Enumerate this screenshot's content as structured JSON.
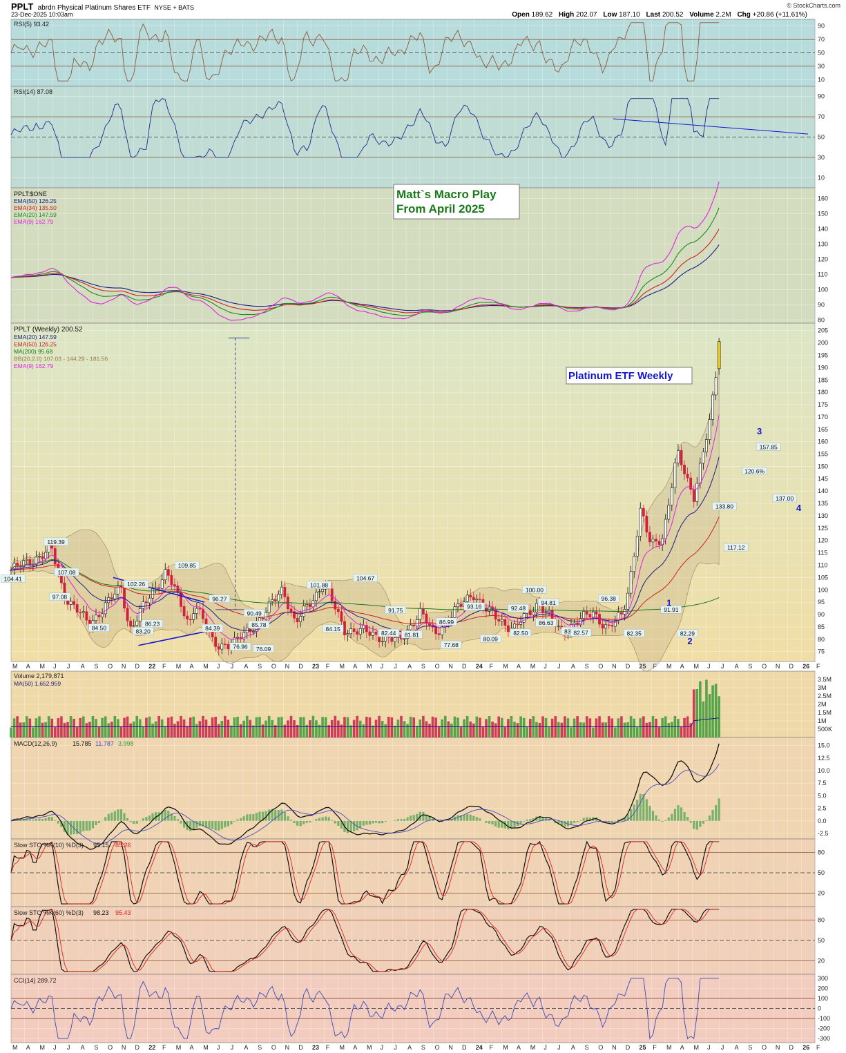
{
  "header": {
    "symbol": "PPLT",
    "name": "abrdn Physical Platinum Shares ETF",
    "exchange": "NYSE + BATS",
    "date": "23-Dec-2025 10:03am",
    "brand": "© StockCharts.com",
    "quote": {
      "open_label": "Open",
      "open": "189.62",
      "high_label": "High",
      "high": "202.07",
      "low_label": "Low",
      "low": "187.10",
      "last_label": "Last",
      "last": "200.52",
      "volume_label": "Volume",
      "volume": "2.2M",
      "chg_label": "Chg",
      "chg": "+20.86 (+11.61%)"
    }
  },
  "colors": {
    "up": "#2a9a2a",
    "down": "#d0213c",
    "ema50": "#1a1a8c",
    "ema34": "#cc2020",
    "ema20": "#1a8c1a",
    "ema9": "#e020e0",
    "blue_line": "#1515d0",
    "rsi5": "#8b5a3c",
    "rsi14": "#1a2a90"
  },
  "chart_data": [
    {
      "panel": "rsi5",
      "type": "line",
      "legend": "RSI(5) 93.42",
      "ylim": [
        0,
        100
      ],
      "yticks": [
        10,
        30,
        50,
        70,
        90
      ],
      "reference_lines": [
        30,
        50,
        70
      ],
      "last_value": 93.42
    },
    {
      "panel": "rsi14",
      "type": "line",
      "legend": "RSI(14) 87.08",
      "ylim": [
        0,
        100
      ],
      "yticks": [
        10,
        30,
        50,
        70,
        90
      ],
      "reference_lines": [
        30,
        50,
        70
      ],
      "last_value": 87.08
    },
    {
      "panel": "ratio",
      "type": "line",
      "title_label": "PPLT:$ONE",
      "annotation": [
        "Matt`s Macro Play",
        "From April 2025"
      ],
      "ylim": [
        78,
        167
      ],
      "yticks": [
        80,
        90,
        100,
        110,
        120,
        130,
        140,
        150,
        160
      ],
      "legend": [
        "EMA(50) 126.25",
        "EMA(34) 135.50",
        "EMA(20) 147.59",
        "EMA(9) 162.79"
      ]
    },
    {
      "panel": "price",
      "type": "candlestick",
      "title_label": "PPLT (Weekly) 200.52",
      "annotation": "Platinum ETF Weekly",
      "ylim": [
        71,
        208
      ],
      "yticks": [
        75,
        80,
        85,
        90,
        95,
        100,
        105,
        110,
        115,
        120,
        125,
        130,
        135,
        140,
        145,
        150,
        155,
        160,
        165,
        170,
        175,
        180,
        185,
        190,
        195,
        200,
        205
      ],
      "legend": [
        "EMA(20) 147.59",
        "EMA(50) 126.25",
        "MA(200) 95.68",
        "BB(20,2.0) 107.03 - 144.29 - 181.56",
        "EMA(9) 162.79"
      ],
      "last_value": 200.52,
      "price_labels": [
        {
          "t": 0.04,
          "v": 104.41,
          "text": "104.41"
        },
        {
          "t": 0.97,
          "v": 119.39,
          "text": "119.39"
        },
        {
          "t": 1.2,
          "v": 107.08,
          "text": "107.08"
        },
        {
          "t": 1.05,
          "v": 97.08,
          "text": "97.08"
        },
        {
          "t": 1.9,
          "v": 84.5,
          "text": "84.50"
        },
        {
          "t": 2.7,
          "v": 102.26,
          "text": "102.26"
        },
        {
          "t": 2.85,
          "v": 83.2,
          "text": "83.20"
        },
        {
          "t": 3.05,
          "v": 86.23,
          "text": "86.23"
        },
        {
          "t": 3.8,
          "v": 109.85,
          "text": "109.85"
        },
        {
          "t": 4.35,
          "v": 84.39,
          "text": "84.39"
        },
        {
          "t": 4.5,
          "v": 96.27,
          "text": "96.27"
        },
        {
          "t": 5.25,
          "v": 90.49,
          "text": "90.49"
        },
        {
          "t": 5.35,
          "v": 85.78,
          "text": "85.78"
        },
        {
          "t": 4.95,
          "v": 76.96,
          "text": "76.96"
        },
        {
          "t": 5.45,
          "v": 76.09,
          "text": "76.09"
        },
        {
          "t": 6.65,
          "v": 101.88,
          "text": "101.88"
        },
        {
          "t": 6.95,
          "v": 84.15,
          "text": "84.15"
        },
        {
          "t": 7.65,
          "v": 104.67,
          "text": "104.67"
        },
        {
          "t": 8.3,
          "v": 91.75,
          "text": "91.75"
        },
        {
          "t": 8.15,
          "v": 82.44,
          "text": "82.44"
        },
        {
          "t": 8.65,
          "v": 81.81,
          "text": "81.81"
        },
        {
          "t": 9.4,
          "v": 86.99,
          "text": "86.99"
        },
        {
          "t": 9.5,
          "v": 77.68,
          "text": "77.68"
        },
        {
          "t": 10.0,
          "v": 93.16,
          "text": "93.16"
        },
        {
          "t": 10.35,
          "v": 80.09,
          "text": "80.09"
        },
        {
          "t": 10.95,
          "v": 92.48,
          "text": "92.48"
        },
        {
          "t": 11.0,
          "v": 82.5,
          "text": "82.50"
        },
        {
          "t": 11.3,
          "v": 100.0,
          "text": "100.00"
        },
        {
          "t": 11.6,
          "v": 94.81,
          "text": "94.81"
        },
        {
          "t": 11.55,
          "v": 86.63,
          "text": "86.63"
        },
        {
          "t": 12.1,
          "v": 83.22,
          "text": "83.22"
        },
        {
          "t": 12.3,
          "v": 82.57,
          "text": "82.57"
        },
        {
          "t": 12.9,
          "v": 96.38,
          "text": "96.38"
        },
        {
          "t": 13.45,
          "v": 82.35,
          "text": "82.35"
        },
        {
          "t": 14.25,
          "v": 91.91,
          "text": "91.91"
        },
        {
          "t": 14.6,
          "v": 82.29,
          "text": "82.29"
        },
        {
          "t": 15.4,
          "v": 133.8,
          "text": "133.80"
        },
        {
          "t": 15.65,
          "v": 117.12,
          "text": "117.12"
        },
        {
          "t": 16.05,
          "v": 148.0,
          "text": "120.6%"
        },
        {
          "t": 16.35,
          "v": 157.85,
          "text": "157.85"
        },
        {
          "t": 16.7,
          "v": 137.0,
          "text": "137.00"
        }
      ],
      "wave_labels": [
        {
          "t": 14.15,
          "v": 93.5,
          "text": "1"
        },
        {
          "t": 14.6,
          "v": 78.0,
          "text": "2"
        },
        {
          "t": 16.1,
          "v": 163.0,
          "text": "3"
        },
        {
          "t": 16.95,
          "v": 132.0,
          "text": "4"
        }
      ]
    },
    {
      "panel": "volume",
      "type": "bar",
      "legend": [
        "Volume 2,179,871",
        "MA(50) 1,652,959"
      ],
      "ylim": [
        0,
        4000000
      ],
      "yticks": [
        500000,
        1000000,
        1500000,
        2000000,
        2500000,
        3000000,
        3500000
      ],
      "ytick_labels": [
        "500K",
        "1M",
        "1.5M",
        "2M",
        "2.5M",
        "3M",
        "3.5M"
      ],
      "last_value": 2179871
    },
    {
      "panel": "macd",
      "type": "line",
      "legend_label": "MACD(12,26,9)",
      "legend_values": [
        "15.785",
        "11.787",
        "3.998"
      ],
      "ylim": [
        -3.6,
        16.6
      ],
      "yticks": [
        -2.5,
        0.0,
        2.5,
        5.0,
        7.5,
        10.0,
        12.5,
        15.0
      ],
      "ytick_labels": [
        "-2.5",
        "0.0",
        "2.5",
        "5.0",
        "7.5",
        "10.0",
        "12.5",
        "15.0"
      ]
    },
    {
      "panel": "sto10",
      "type": "line",
      "legend_label": "Slow STO %K(10) %D(3)",
      "legend_values": [
        "95.15",
        "85.26"
      ],
      "ylim": [
        0,
        100
      ],
      "yticks": [
        20,
        50,
        80
      ],
      "reference_lines": [
        20,
        50,
        80
      ]
    },
    {
      "panel": "sto60",
      "type": "line",
      "legend_label": "Slow STO %K(60) %D(3)",
      "legend_values": [
        "98.23",
        "95.43"
      ],
      "ylim": [
        0,
        100
      ],
      "yticks": [
        20,
        50,
        80
      ],
      "reference_lines": [
        20,
        50,
        80
      ]
    },
    {
      "panel": "cci",
      "type": "line",
      "legend": "CCI(14) 289.72",
      "ylim": [
        -340,
        340
      ],
      "yticks": [
        -300,
        -200,
        -100,
        0,
        100,
        200,
        300
      ],
      "reference_lines": [
        -100,
        0,
        100
      ],
      "last_value": 289.72
    }
  ],
  "x_axis": {
    "range_months": [
      0,
      59
    ],
    "labels": [
      "M",
      "A",
      "M",
      "J",
      "J",
      "A",
      "S",
      "O",
      "N",
      "D",
      "22",
      "F",
      "M",
      "A",
      "M",
      "J",
      "J",
      "A",
      "S",
      "O",
      "N",
      "D",
      "23",
      "F",
      "M",
      "A",
      "M",
      "J",
      "J",
      "A",
      "S",
      "O",
      "N",
      "D",
      "24",
      "F",
      "M",
      "A",
      "M",
      "J",
      "J",
      "A",
      "S",
      "O",
      "N",
      "D",
      "25",
      "F",
      "M",
      "A",
      "M",
      "J",
      "J",
      "A",
      "S",
      "O",
      "N",
      "D",
      "26",
      "F"
    ]
  }
}
